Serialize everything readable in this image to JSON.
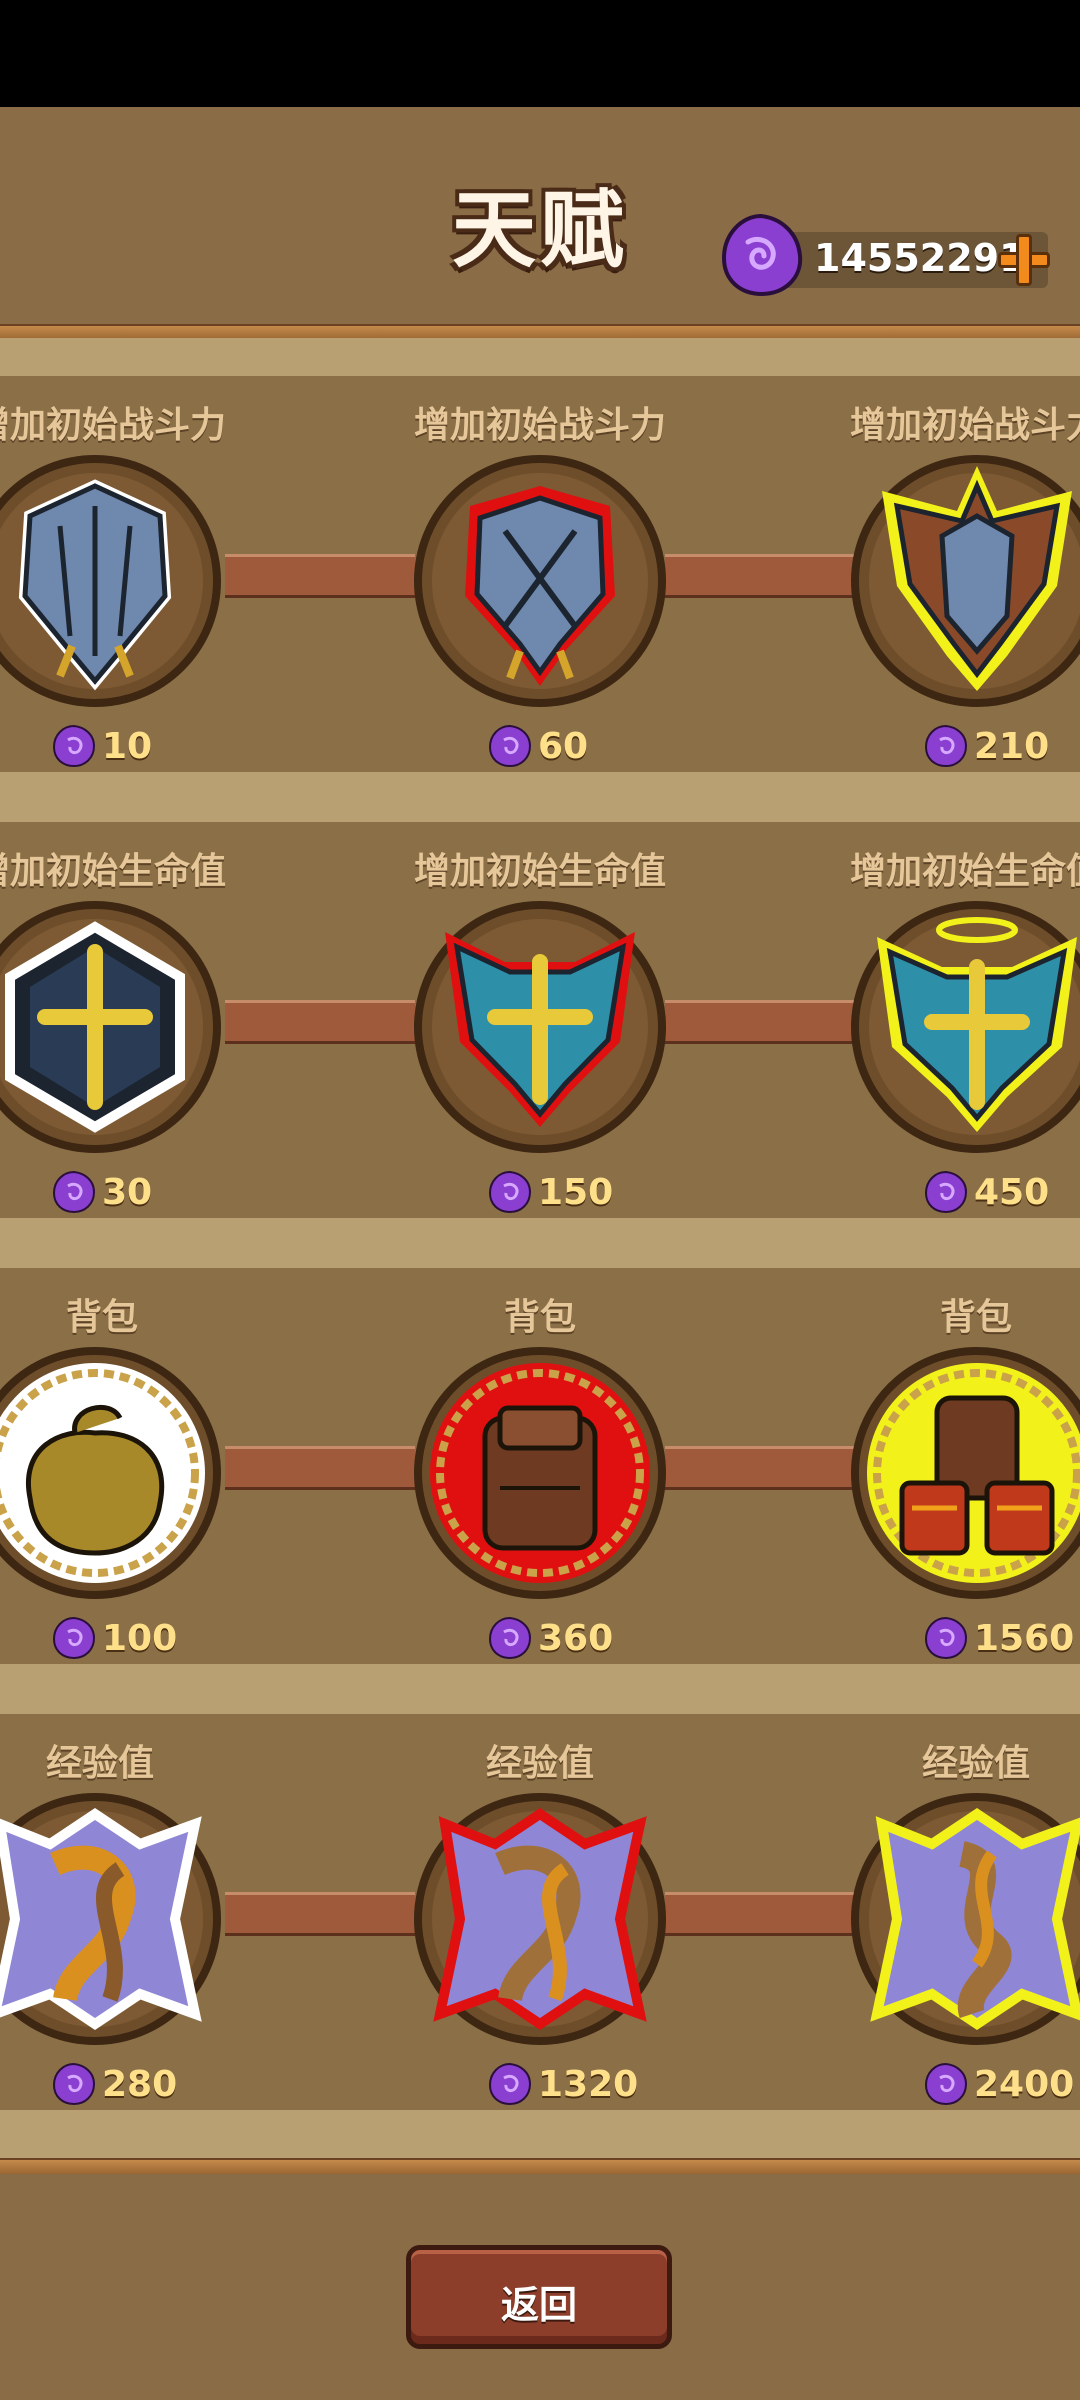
{
  "header": {
    "title": "天赋"
  },
  "currency": {
    "amount": "14552291",
    "icon": "purple-gem-icon",
    "add_icon": "plus-icon"
  },
  "rows": [
    {
      "label": "增加初始战斗力",
      "tiers": [
        {
          "cost": "10",
          "tier": "white"
        },
        {
          "cost": "60",
          "tier": "red"
        },
        {
          "cost": "210",
          "tier": "yellow"
        }
      ]
    },
    {
      "label": "增加初始生命值",
      "tiers": [
        {
          "cost": "30",
          "tier": "white"
        },
        {
          "cost": "150",
          "tier": "red"
        },
        {
          "cost": "450",
          "tier": "yellow"
        }
      ]
    },
    {
      "label": "背包",
      "tiers": [
        {
          "cost": "100",
          "tier": "white"
        },
        {
          "cost": "360",
          "tier": "red"
        },
        {
          "cost": "1560",
          "tier": "yellow"
        }
      ]
    },
    {
      "label": "经验值",
      "tiers": [
        {
          "cost": "280",
          "tier": "white"
        },
        {
          "cost": "1320",
          "tier": "red"
        },
        {
          "cost": "2400",
          "tier": "yellow"
        }
      ]
    }
  ],
  "labels": {
    "r0": [
      "增加初始战斗力",
      "增加初始战斗力",
      "增加初始战斗力"
    ],
    "r1": [
      "增加初始生命值",
      "增加初始生命值",
      "增加初始生命值"
    ],
    "r2": [
      "背包",
      "背包",
      "背包"
    ],
    "r3": [
      "经验值",
      "经验值",
      "经验值"
    ]
  },
  "footer": {
    "back_label": "返回"
  },
  "colors": {
    "glow_white": "#ffffff",
    "glow_red": "#e01010",
    "glow_yellow": "#f2f21a",
    "gem": "#8a3fd0",
    "cost_text": "#ffe08a"
  }
}
